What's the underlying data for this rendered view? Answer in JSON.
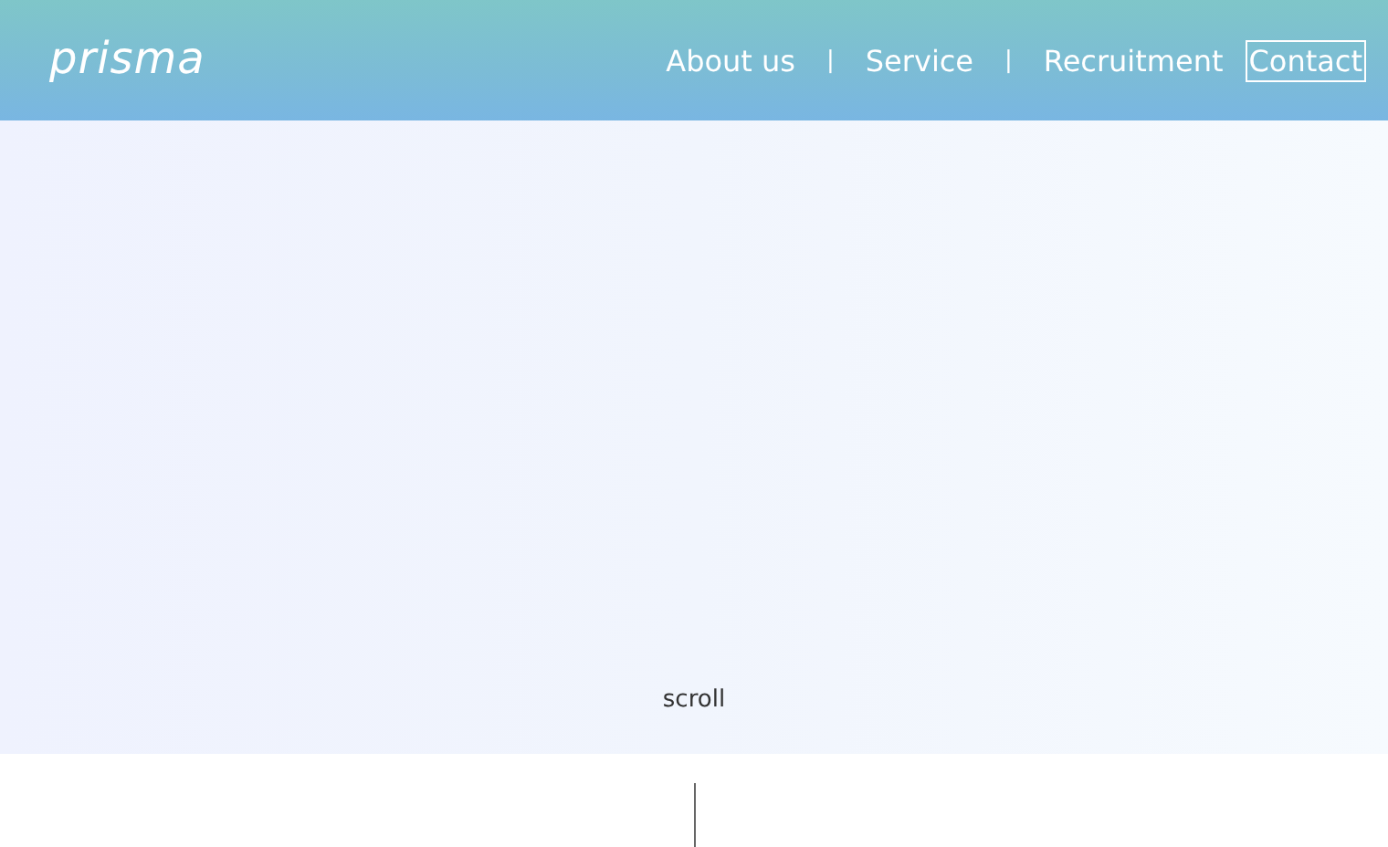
{
  "logo": "prisma",
  "nav": [
    {
      "kind": "link",
      "label": "About us",
      "selected": false
    },
    {
      "kind": "separator",
      "label": "|"
    },
    {
      "kind": "link",
      "label": "Service",
      "selected": false
    },
    {
      "kind": "separator",
      "label": "|"
    },
    {
      "kind": "link",
      "label": "Recruitment",
      "selected": false
    },
    {
      "kind": "link",
      "label": "Contact",
      "selected": true
    }
  ],
  "hero": {
    "scroll_label": "scroll"
  }
}
